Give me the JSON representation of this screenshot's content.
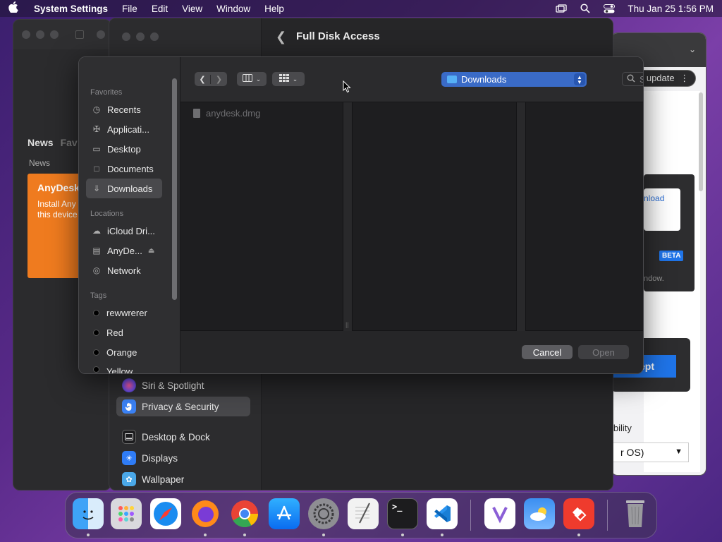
{
  "menubar": {
    "app": "System Settings",
    "items": [
      "File",
      "Edit",
      "View",
      "Window",
      "Help"
    ],
    "datetime": "Thu Jan 25  1:56 PM"
  },
  "anydesk": {
    "tab_news": "News",
    "tab_fav": "Fav",
    "sub": "News",
    "card_title": "AnyDesk",
    "card_line1": "Install Any",
    "card_line2": "this device"
  },
  "browser_win": {
    "update": "o update",
    "download": "nload",
    "beta": "BETA",
    "window_text": "ndow.",
    "accept": "ept",
    "compat": "ibility",
    "select_value": "r OS)"
  },
  "settings": {
    "title": "Full Disk Access",
    "sidebar": [
      {
        "label": "Siri & Spotlight",
        "icon": "siri-icon",
        "color": "#7a4fd8"
      },
      {
        "label": "Privacy & Security",
        "icon": "hand-icon",
        "color": "#3b82f6"
      },
      {
        "label": "Desktop & Dock",
        "icon": "dock-icon",
        "color": "#1c1c1e"
      },
      {
        "label": "Displays",
        "icon": "sun-icon",
        "color": "#2f7cf6"
      },
      {
        "label": "Wallpaper",
        "icon": "flower-icon",
        "color": "#4aa8e8"
      }
    ]
  },
  "dialog": {
    "favorites_label": "Favorites",
    "favorites": [
      {
        "label": "Recents",
        "icon": "clock-icon"
      },
      {
        "label": "Applicati...",
        "icon": "applications-icon"
      },
      {
        "label": "Desktop",
        "icon": "desktop-icon"
      },
      {
        "label": "Documents",
        "icon": "document-icon"
      },
      {
        "label": "Downloads",
        "icon": "download-icon"
      }
    ],
    "locations_label": "Locations",
    "locations": [
      {
        "label": "iCloud Dri...",
        "icon": "cloud-icon"
      },
      {
        "label": "AnyDe...",
        "icon": "drive-icon"
      },
      {
        "label": "Network",
        "icon": "globe-icon"
      }
    ],
    "tags_label": "Tags",
    "tags": [
      "rewwrerer",
      "Red",
      "Orange",
      "Yellow"
    ],
    "location_value": "Downloads",
    "search_placeholder": "Search",
    "file": "anydesk.dmg",
    "cancel": "Cancel",
    "open": "Open"
  },
  "dock": [
    {
      "name": "Finder",
      "color": "#2b8cf0"
    },
    {
      "name": "Launchpad",
      "color": "#d9d9d9"
    },
    {
      "name": "Safari",
      "color": "#1a8cf0"
    },
    {
      "name": "Firefox",
      "color": "#ff6b1a"
    },
    {
      "name": "Chrome",
      "color": "#ffffff"
    },
    {
      "name": "App Store",
      "color": "#1a8cf0"
    },
    {
      "name": "System Settings",
      "color": "#8e8e93"
    },
    {
      "name": "TextEdit",
      "color": "#f2f2f2"
    },
    {
      "name": "Terminal",
      "color": "#1c1c1e"
    },
    {
      "name": "VS Code",
      "color": "#ffffff"
    },
    {
      "name": "Visual Studio",
      "color": "#ffffff"
    },
    {
      "name": "Weather",
      "color": "#3b8ff0"
    },
    {
      "name": "AnyDesk",
      "color": "#ef3b2d"
    },
    {
      "name": "Trash",
      "color": "#9a9a9e"
    }
  ]
}
